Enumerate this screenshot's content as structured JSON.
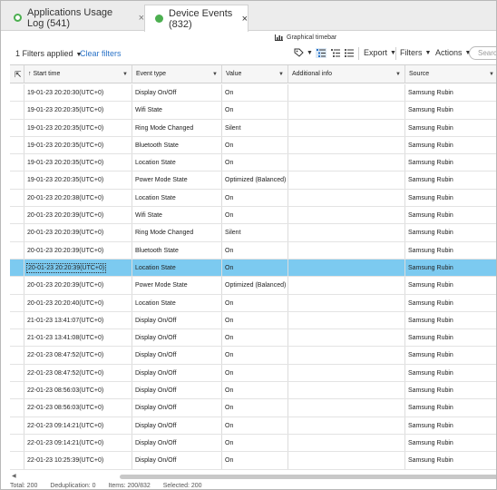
{
  "tabs": [
    {
      "label": "Applications Usage Log (541)",
      "close": "×"
    },
    {
      "label": "Device Events (832)",
      "close": "×"
    }
  ],
  "toolbar": {
    "timebar": "Graphical timebar",
    "filters_applied": "1 Filters applied",
    "clear_filters": "Clear filters",
    "export": "Export",
    "filters": "Filters",
    "actions": "Actions",
    "search_placeholder": "Search"
  },
  "columns": {
    "start_time": "Start time",
    "event_type": "Event type",
    "value": "Value",
    "additional_info": "Additional info",
    "source": "Source"
  },
  "rows": [
    {
      "time": "19-01-23 20:20:30(UTC+0)",
      "type": "Display On/Off",
      "value": "On",
      "info": "",
      "source": "Samsung Rubin"
    },
    {
      "time": "19-01-23 20:20:35(UTC+0)",
      "type": "Wifi State",
      "value": "On",
      "info": "",
      "source": "Samsung Rubin"
    },
    {
      "time": "19-01-23 20:20:35(UTC+0)",
      "type": "Ring Mode Changed",
      "value": "Silent",
      "info": "",
      "source": "Samsung Rubin"
    },
    {
      "time": "19-01-23 20:20:35(UTC+0)",
      "type": "Bluetooth State",
      "value": "On",
      "info": "",
      "source": "Samsung Rubin"
    },
    {
      "time": "19-01-23 20:20:35(UTC+0)",
      "type": "Location State",
      "value": "On",
      "info": "",
      "source": "Samsung Rubin"
    },
    {
      "time": "19-01-23 20:20:35(UTC+0)",
      "type": "Power Mode State",
      "value": "Optimized (Balanced)",
      "info": "",
      "source": "Samsung Rubin"
    },
    {
      "time": "20-01-23 20:20:38(UTC+0)",
      "type": "Location State",
      "value": "On",
      "info": "",
      "source": "Samsung Rubin"
    },
    {
      "time": "20-01-23 20:20:39(UTC+0)",
      "type": "Wifi State",
      "value": "On",
      "info": "",
      "source": "Samsung Rubin"
    },
    {
      "time": "20-01-23 20:20:39(UTC+0)",
      "type": "Ring Mode Changed",
      "value": "Silent",
      "info": "",
      "source": "Samsung Rubin"
    },
    {
      "time": "20-01-23 20:20:39(UTC+0)",
      "type": "Bluetooth State",
      "value": "On",
      "info": "",
      "source": "Samsung Rubin"
    },
    {
      "time": "20-01-23 20:20:39(UTC+0)",
      "type": "Location State",
      "value": "On",
      "info": "",
      "source": "Samsung Rubin",
      "selected": true
    },
    {
      "time": "20-01-23 20:20:39(UTC+0)",
      "type": "Power Mode State",
      "value": "Optimized (Balanced)",
      "info": "",
      "source": "Samsung Rubin"
    },
    {
      "time": "20-01-23 20:20:40(UTC+0)",
      "type": "Location State",
      "value": "On",
      "info": "",
      "source": "Samsung Rubin"
    },
    {
      "time": "21-01-23 13:41:07(UTC+0)",
      "type": "Display On/Off",
      "value": "On",
      "info": "",
      "source": "Samsung Rubin"
    },
    {
      "time": "21-01-23 13:41:08(UTC+0)",
      "type": "Display On/Off",
      "value": "On",
      "info": "",
      "source": "Samsung Rubin"
    },
    {
      "time": "22-01-23 08:47:52(UTC+0)",
      "type": "Display On/Off",
      "value": "On",
      "info": "",
      "source": "Samsung Rubin"
    },
    {
      "time": "22-01-23 08:47:52(UTC+0)",
      "type": "Display On/Off",
      "value": "On",
      "info": "",
      "source": "Samsung Rubin"
    },
    {
      "time": "22-01-23 08:56:03(UTC+0)",
      "type": "Display On/Off",
      "value": "On",
      "info": "",
      "source": "Samsung Rubin"
    },
    {
      "time": "22-01-23 08:56:03(UTC+0)",
      "type": "Display On/Off",
      "value": "On",
      "info": "",
      "source": "Samsung Rubin"
    },
    {
      "time": "22-01-23 09:14:21(UTC+0)",
      "type": "Display On/Off",
      "value": "On",
      "info": "",
      "source": "Samsung Rubin"
    },
    {
      "time": "22-01-23 09:14:21(UTC+0)",
      "type": "Display On/Off",
      "value": "On",
      "info": "",
      "source": "Samsung Rubin"
    },
    {
      "time": "22-01-23 10:25:39(UTC+0)",
      "type": "Display On/Off",
      "value": "On",
      "info": "",
      "source": "Samsung Rubin"
    }
  ],
  "status": {
    "total": "Total: 200",
    "deduplication": "Deduplication: 0",
    "items": "Items: 200/832",
    "selected": "Selected: 200"
  },
  "colors": {
    "tab_dot": "#4caf50",
    "link": "#2a73c7",
    "selected_row": "#7ccaf0"
  },
  "icons": [
    "chart-icon",
    "tag-icon",
    "group-icon",
    "list-icon",
    "tree-icon",
    "sort-up-icon",
    "resize-icon",
    "chevron-down-icon",
    "close-icon"
  ]
}
